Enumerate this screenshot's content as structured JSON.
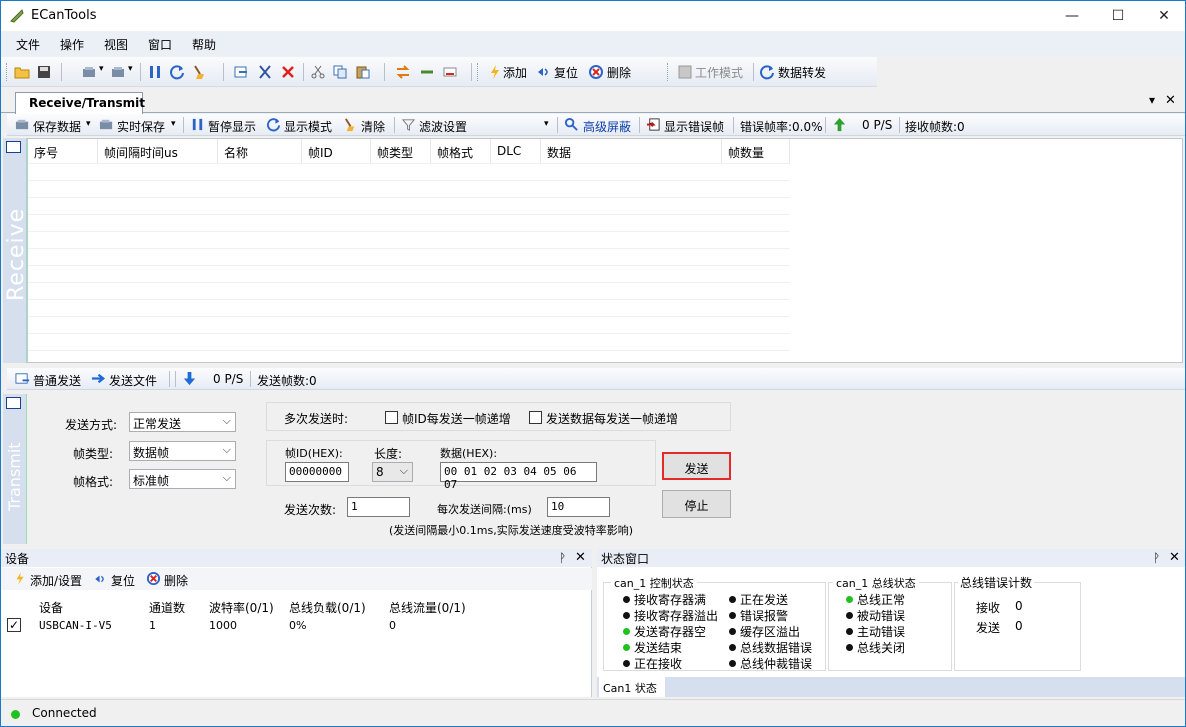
{
  "window": {
    "title": "ECanTools",
    "minimize": "—",
    "maximize": "☐",
    "close": "✕"
  },
  "menu": [
    "文件",
    "操作",
    "视图",
    "窗口",
    "帮助"
  ],
  "toolbar": {
    "add": "添加",
    "reset": "复位",
    "delete": "删除",
    "work_mode": "工作模式",
    "data_forward": "数据转发"
  },
  "tab": {
    "label": "Receive/Transmit",
    "chevron": "▾",
    "close": "✕"
  },
  "rx_toolbar": {
    "save_data": "保存数据",
    "realtime_save": "实时保存",
    "pause_display": "暂停显示",
    "display_mode": "显示模式",
    "clear": "清除",
    "filter_settings": "滤波设置",
    "advanced_mask": "高级屏蔽",
    "show_error_frames": "显示错误帧",
    "error_rate": "错误帧率:0.0%",
    "rate": "0 P/S",
    "rx_frames": "接收帧数:0"
  },
  "rx_table": {
    "side_label": "Receive",
    "columns": [
      "序号",
      "帧间隔时间us",
      "名称",
      "帧ID",
      "帧类型",
      "帧格式",
      "DLC",
      "数据",
      "帧数量"
    ]
  },
  "tx_toolbar": {
    "normal_send": "普通发送",
    "send_file": "发送文件",
    "rate": "0 P/S",
    "tx_frames": "发送帧数:0"
  },
  "tx": {
    "side_label": "Transmit",
    "send_mode_label": "发送方式:",
    "send_mode_value": "正常发送",
    "frame_type_label": "帧类型:",
    "frame_type_value": "数据帧",
    "frame_format_label": "帧格式:",
    "frame_format_value": "标准帧",
    "multi_send_label": "多次发送时:",
    "id_increment_label": "帧ID每发送一帧递增",
    "data_increment_label": "发送数据每发送一帧递增",
    "frame_id_label": "帧ID(HEX):",
    "frame_id_value": "00000000",
    "length_label": "长度:",
    "length_value": "8",
    "data_label": "数据(HEX):",
    "data_value": "00 01 02 03 04 05 06 07",
    "send_count_label": "发送次数:",
    "send_count_value": "1",
    "interval_label": "每次发送间隔:(ms)",
    "interval_value": "10",
    "note": "(发送间隔最小0.1ms,实际发送速度受波特率影响)",
    "send_button": "发送",
    "stop_button": "停止"
  },
  "devices": {
    "title": "设备",
    "add_settings": "添加/设置",
    "reset": "复位",
    "delete": "删除",
    "columns": [
      "设备",
      "通道数",
      "波特率(0/1)",
      "总线负载(0/1)",
      "总线流量(0/1)"
    ],
    "rows": [
      {
        "checked": true,
        "device": "USBCAN-I-V5",
        "channels": "1",
        "baud": "1000",
        "load": "0%",
        "traffic": "0"
      }
    ]
  },
  "status": {
    "title": "状态窗口",
    "ctrl_title": "can_1 控制状态",
    "ctrl_left": [
      {
        "label": "接收寄存器满",
        "color": "black"
      },
      {
        "label": "接收寄存器溢出",
        "color": "black"
      },
      {
        "label": "发送寄存器空",
        "color": "green"
      },
      {
        "label": "发送结束",
        "color": "green"
      },
      {
        "label": "正在接收",
        "color": "black"
      }
    ],
    "ctrl_right": [
      "正在发送",
      "错误报警",
      "缓存区溢出",
      "总线数据错误",
      "总线仲裁错误"
    ],
    "bus_title": "can_1 总线状态",
    "bus": [
      {
        "label": "总线正常",
        "color": "green"
      },
      {
        "label": "被动错误",
        "color": "black"
      },
      {
        "label": "主动错误",
        "color": "black"
      },
      {
        "label": "总线关闭",
        "color": "black"
      }
    ],
    "err_title": "总线错误计数",
    "rx_label": "接收",
    "rx_value": "0",
    "tx_label": "发送",
    "tx_value": "0",
    "tab": "Can1 状态"
  },
  "panel_pin": "ᚹ",
  "statusbar": {
    "text": "Connected",
    "color": "#21c21f"
  }
}
